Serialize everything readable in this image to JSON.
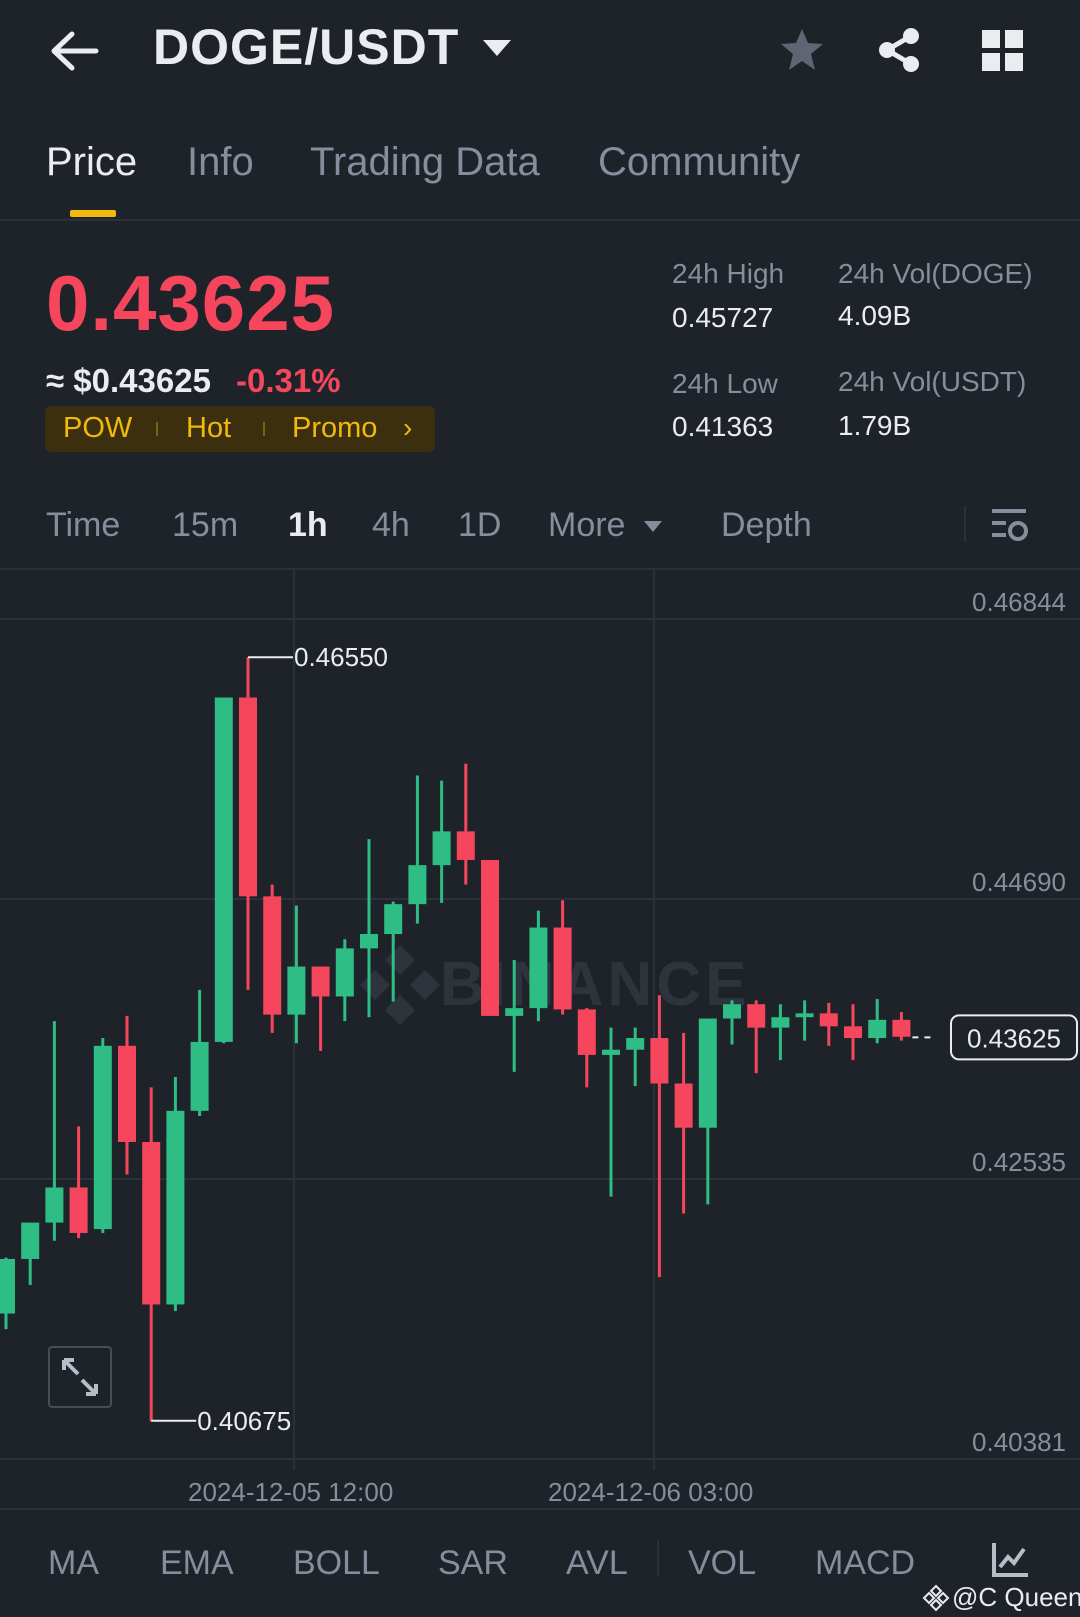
{
  "header": {
    "pair": "DOGE/USDT"
  },
  "tabs": [
    {
      "label": "Price",
      "active": true
    },
    {
      "label": "Info"
    },
    {
      "label": "Trading Data"
    },
    {
      "label": "Community"
    }
  ],
  "price": {
    "last": "0.43625",
    "usd": "≈ $0.43625",
    "change": "-0.31%",
    "tags": [
      "POW",
      "Hot",
      "Promo"
    ]
  },
  "stats": {
    "high_label": "24h High",
    "high_value": "0.45727",
    "low_label": "24h Low",
    "low_value": "0.41363",
    "vol_base_label": "24h Vol(DOGE)",
    "vol_base_value": "4.09B",
    "vol_quote_label": "24h Vol(USDT)",
    "vol_quote_value": "1.79B"
  },
  "intervals": [
    {
      "label": "Time"
    },
    {
      "label": "15m"
    },
    {
      "label": "1h",
      "active": true
    },
    {
      "label": "4h"
    },
    {
      "label": "1D"
    },
    {
      "label": "More"
    },
    {
      "label": "Depth"
    }
  ],
  "chart": {
    "y_ticks": [
      "0.46844",
      "0.44690",
      "0.42535",
      "0.40381"
    ],
    "time_labels": [
      "2024-12-05 12:00",
      "2024-12-06 03:00"
    ],
    "high_marker": "0.46550",
    "low_marker": "0.40675",
    "current_price_label": "0.43625",
    "watermark": "BINANCE"
  },
  "chart_data": {
    "type": "candlestick",
    "interval": "1h",
    "ylim": [
      0.40381,
      0.46844
    ],
    "y_ticks": [
      0.46844,
      0.4469,
      0.42535,
      0.40381
    ],
    "x_ticks": [
      "2024-12-05 12:00",
      "2024-12-06 03:00"
    ],
    "max_marker": 0.4655,
    "min_marker": 0.40675,
    "last_price": 0.43625,
    "up_color": "#2ebd85",
    "down_color": "#f6465d",
    "candles": [
      {
        "o": 0.415,
        "h": 0.4193,
        "l": 0.4138,
        "c": 0.4192
      },
      {
        "o": 0.4192,
        "h": 0.422,
        "l": 0.4172,
        "c": 0.422
      },
      {
        "o": 0.422,
        "h": 0.4375,
        "l": 0.4206,
        "c": 0.4247
      },
      {
        "o": 0.4247,
        "h": 0.4294,
        "l": 0.4208,
        "c": 0.4212
      },
      {
        "o": 0.4215,
        "h": 0.4362,
        "l": 0.4212,
        "c": 0.4356
      },
      {
        "o": 0.4356,
        "h": 0.4379,
        "l": 0.4257,
        "c": 0.4282
      },
      {
        "o": 0.4282,
        "h": 0.4324,
        "l": 0.4067,
        "c": 0.4157
      },
      {
        "o": 0.4157,
        "h": 0.4332,
        "l": 0.4152,
        "c": 0.4306
      },
      {
        "o": 0.4306,
        "h": 0.4399,
        "l": 0.4302,
        "c": 0.4359
      },
      {
        "o": 0.4359,
        "h": 0.4592,
        "l": 0.4358,
        "c": 0.4624
      },
      {
        "o": 0.4624,
        "h": 0.4655,
        "l": 0.4399,
        "c": 0.4471
      },
      {
        "o": 0.4471,
        "h": 0.448,
        "l": 0.4366,
        "c": 0.438
      },
      {
        "o": 0.438,
        "h": 0.4464,
        "l": 0.4358,
        "c": 0.4417
      },
      {
        "o": 0.4417,
        "h": 0.4405,
        "l": 0.4352,
        "c": 0.4394
      },
      {
        "o": 0.4394,
        "h": 0.4438,
        "l": 0.4375,
        "c": 0.4431
      },
      {
        "o": 0.4431,
        "h": 0.4515,
        "l": 0.4378,
        "c": 0.4442
      },
      {
        "o": 0.4442,
        "h": 0.4467,
        "l": 0.439,
        "c": 0.4465
      },
      {
        "o": 0.4465,
        "h": 0.4564,
        "l": 0.445,
        "c": 0.4495
      },
      {
        "o": 0.4495,
        "h": 0.456,
        "l": 0.4466,
        "c": 0.4521
      },
      {
        "o": 0.4521,
        "h": 0.4573,
        "l": 0.448,
        "c": 0.4499
      },
      {
        "o": 0.4499,
        "h": 0.4499,
        "l": 0.438,
        "c": 0.4379
      },
      {
        "o": 0.4379,
        "h": 0.4422,
        "l": 0.4336,
        "c": 0.4385
      },
      {
        "o": 0.4385,
        "h": 0.446,
        "l": 0.4375,
        "c": 0.4447
      },
      {
        "o": 0.4447,
        "h": 0.4468,
        "l": 0.438,
        "c": 0.4384
      },
      {
        "o": 0.4384,
        "h": 0.4385,
        "l": 0.4324,
        "c": 0.4349
      },
      {
        "o": 0.4349,
        "h": 0.437,
        "l": 0.424,
        "c": 0.4353
      },
      {
        "o": 0.4353,
        "h": 0.437,
        "l": 0.4325,
        "c": 0.4362
      },
      {
        "o": 0.4362,
        "h": 0.4395,
        "l": 0.4178,
        "c": 0.4327
      },
      {
        "o": 0.4327,
        "h": 0.4366,
        "l": 0.4227,
        "c": 0.4293
      },
      {
        "o": 0.4293,
        "h": 0.4368,
        "l": 0.4234,
        "c": 0.4377
      },
      {
        "o": 0.4377,
        "h": 0.4391,
        "l": 0.4357,
        "c": 0.4388
      },
      {
        "o": 0.4388,
        "h": 0.4391,
        "l": 0.4335,
        "c": 0.437
      },
      {
        "o": 0.437,
        "h": 0.4388,
        "l": 0.4345,
        "c": 0.4378
      },
      {
        "o": 0.4378,
        "h": 0.4391,
        "l": 0.436,
        "c": 0.4381
      },
      {
        "o": 0.4381,
        "h": 0.4389,
        "l": 0.4356,
        "c": 0.4371
      },
      {
        "o": 0.4371,
        "h": 0.4388,
        "l": 0.4345,
        "c": 0.4362
      },
      {
        "o": 0.4362,
        "h": 0.4392,
        "l": 0.4358,
        "c": 0.4376
      },
      {
        "o": 0.4376,
        "h": 0.4382,
        "l": 0.436,
        "c": 0.4363
      }
    ]
  },
  "indicators": [
    "MA",
    "EMA",
    "BOLL",
    "SAR",
    "AVL",
    "VOL",
    "MACD"
  ],
  "watermark_user": "@C Queen",
  "colors": {
    "background": "#1e2329",
    "up": "#2ebd85",
    "down": "#f6465d",
    "accent": "#f0b90b",
    "muted_text": "#848e9c"
  }
}
